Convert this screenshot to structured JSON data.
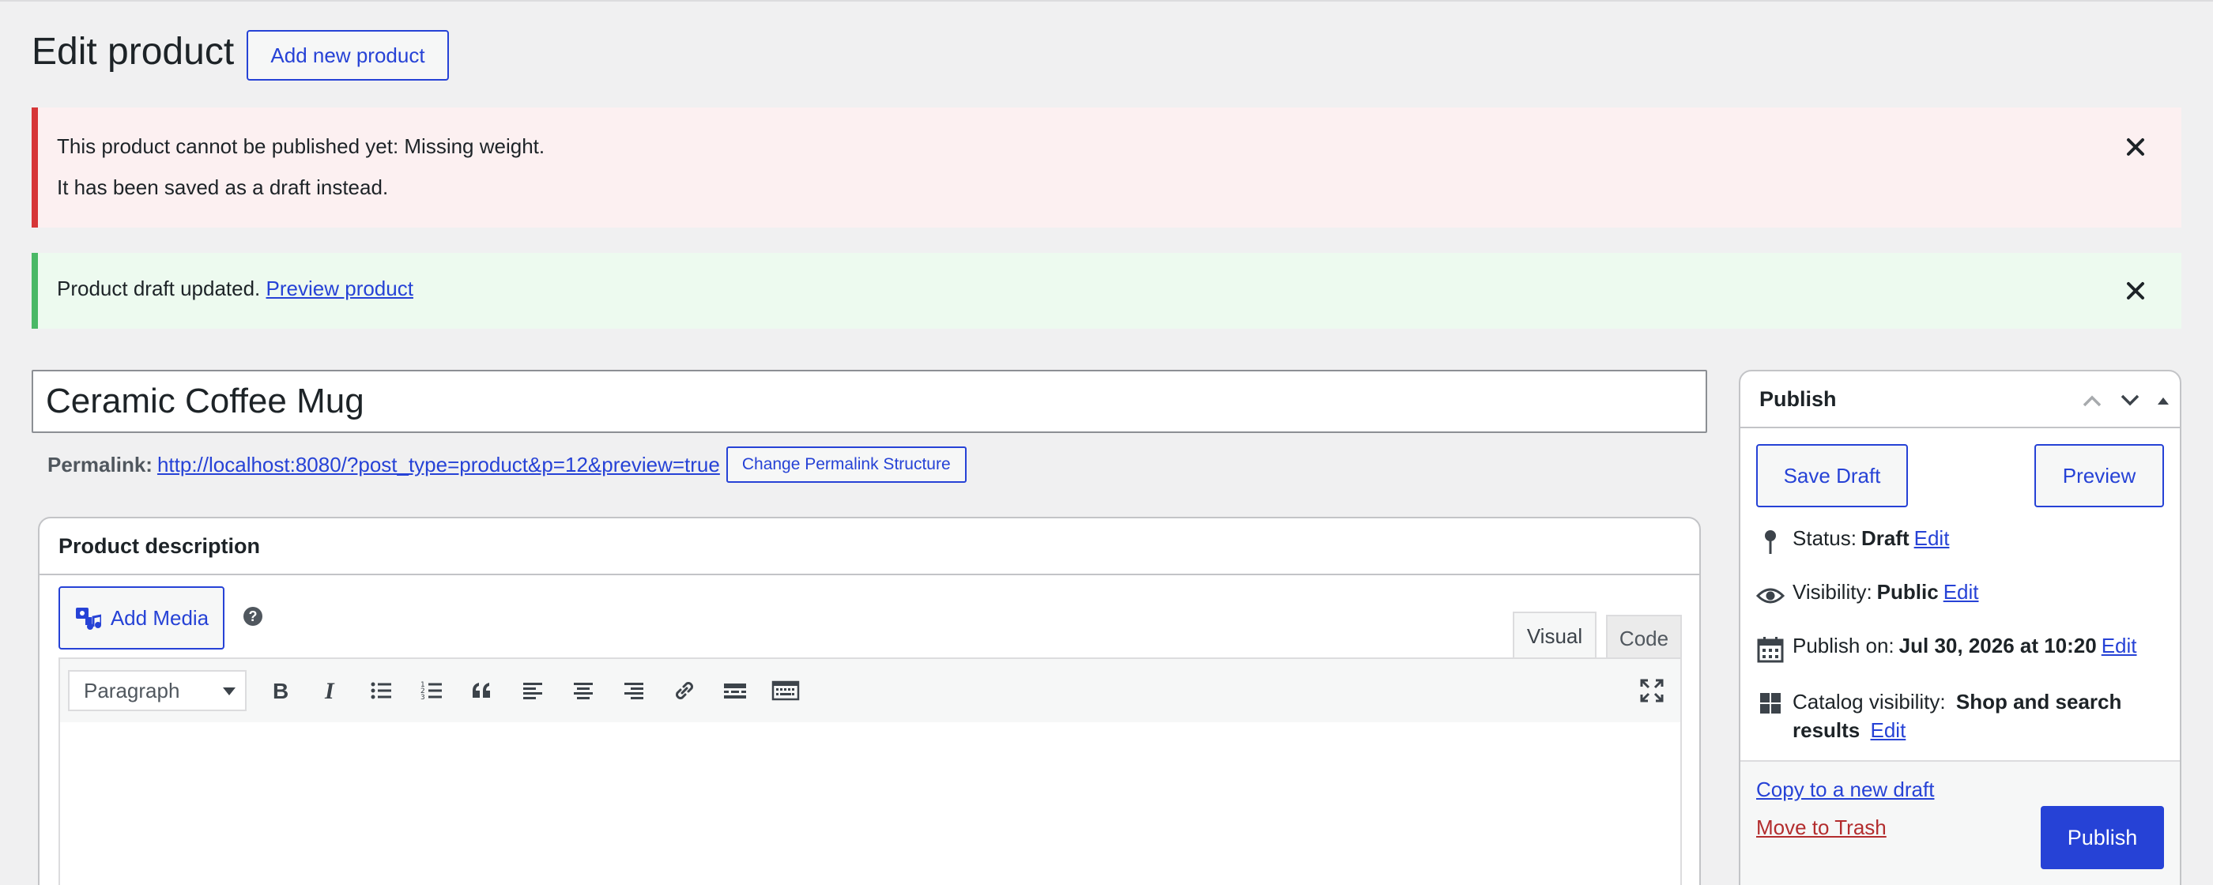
{
  "header": {
    "title": "Edit product",
    "add_new_label": "Add new product"
  },
  "notices": {
    "error": {
      "line1": "This product cannot be published yet: Missing weight.",
      "line2": "It has been saved as a draft instead."
    },
    "success": {
      "text": "Product draft updated.",
      "link": "Preview product"
    }
  },
  "post": {
    "title": "Ceramic Coffee Mug",
    "permalink_label": "Permalink:",
    "permalink_url": "http://localhost:8080/?post_type=product&p=12&preview=true",
    "change_permalink_label": "Change Permalink Structure"
  },
  "description": {
    "heading": "Product description",
    "add_media_label": "Add Media",
    "help_glyph": "?",
    "tabs": {
      "visual": "Visual",
      "code": "Code"
    },
    "format_selected": "Paragraph",
    "toolbar_icons": [
      "bold-icon",
      "italic-icon",
      "bullet-list-icon",
      "numbered-list-icon",
      "blockquote-icon",
      "align-left-icon",
      "align-center-icon",
      "align-right-icon",
      "link-icon",
      "read-more-icon",
      "toolbar-toggle-icon",
      "fullscreen-icon"
    ]
  },
  "publish": {
    "heading": "Publish",
    "save_draft_label": "Save Draft",
    "preview_label": "Preview",
    "status_label": "Status:",
    "status_value": "Draft",
    "visibility_label": "Visibility:",
    "visibility_value": "Public",
    "publish_on_label": "Publish on:",
    "publish_on_value": "Jul 30, 2026 at 10:20",
    "catalog_label": "Catalog visibility:",
    "catalog_value_1": "Shop and search",
    "catalog_value_2": "results",
    "edit_label": "Edit",
    "copy_label": "Copy to a new draft",
    "trash_label": "Move to Trash",
    "publish_label": "Publish"
  },
  "colors": {
    "accent": "#2642d6",
    "error": "#d63638",
    "success": "#4ab866",
    "trash": "#b32d2e"
  }
}
